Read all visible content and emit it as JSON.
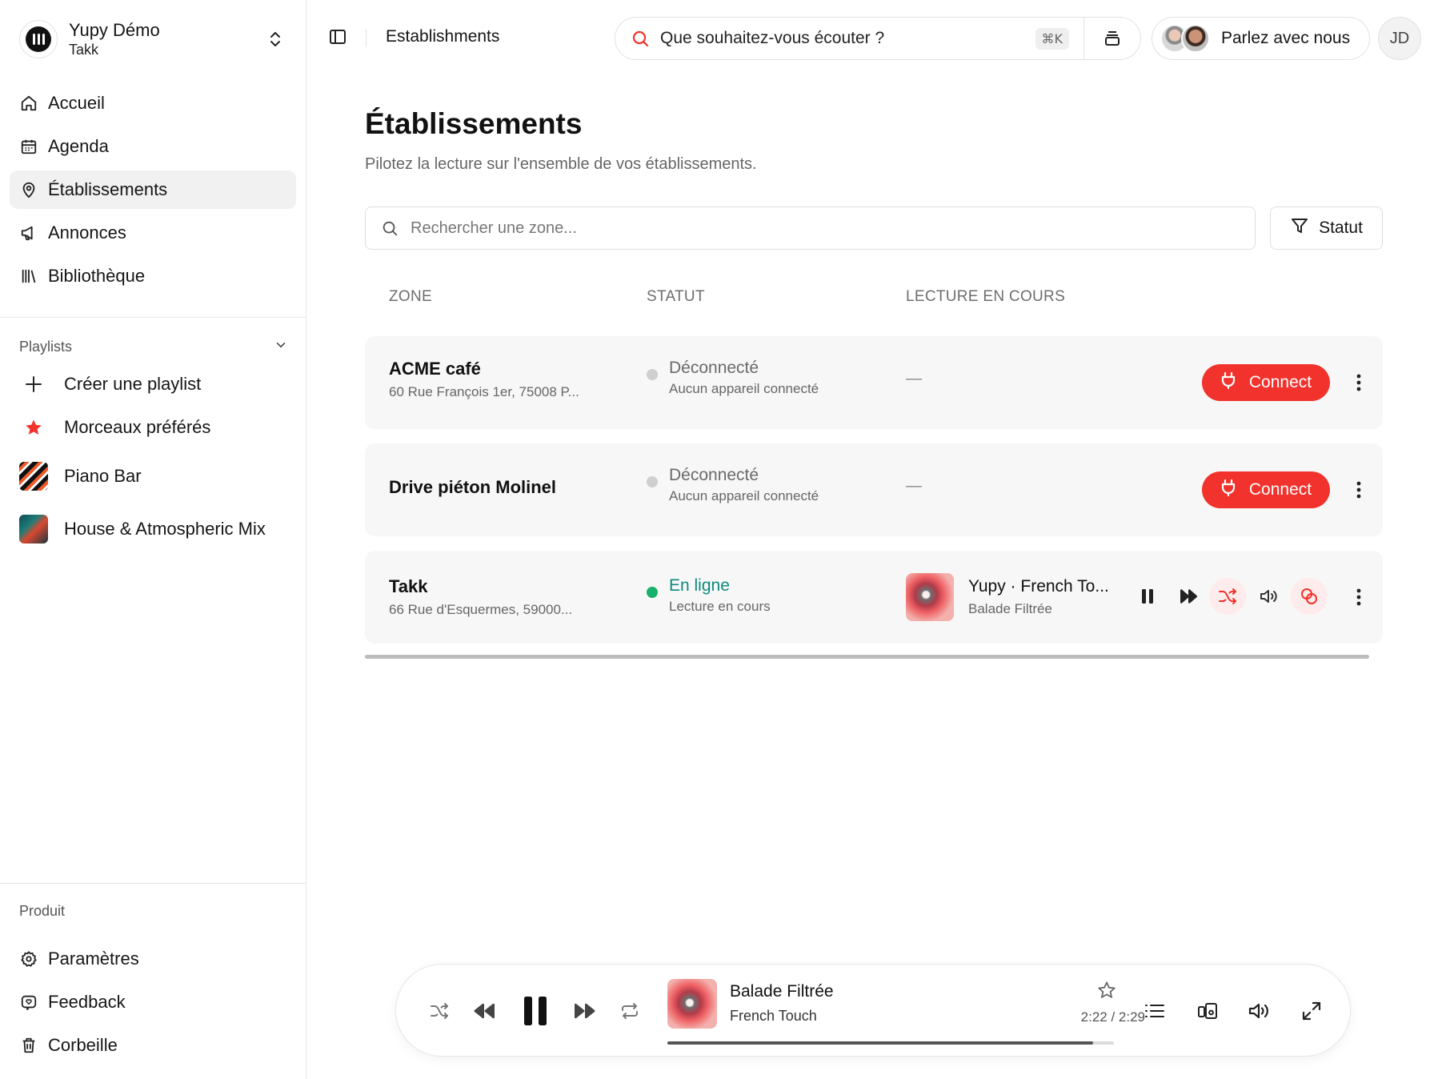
{
  "sidebar": {
    "account": {
      "name": "Yupy Démo",
      "sub": "Takk"
    },
    "nav": [
      {
        "label": "Accueil",
        "icon": "home-icon"
      },
      {
        "label": "Agenda",
        "icon": "calendar-icon"
      },
      {
        "label": "Établissements",
        "icon": "map-pin-icon",
        "active": true
      },
      {
        "label": "Annonces",
        "icon": "megaphone-icon"
      },
      {
        "label": "Bibliothèque",
        "icon": "library-icon"
      }
    ],
    "playlists_header": "Playlists",
    "playlists": [
      {
        "label": "Créer une playlist",
        "icon": "plus-icon"
      },
      {
        "label": "Morceaux préférés",
        "icon": "star-icon"
      },
      {
        "label": "Piano Bar",
        "icon": "playlist-cover"
      },
      {
        "label": "House & Atmospheric Mix",
        "icon": "playlist-cover"
      }
    ],
    "product_header": "Produit",
    "product_nav": [
      {
        "label": "Paramètres",
        "icon": "gear-icon"
      },
      {
        "label": "Feedback",
        "icon": "heart-chat-icon"
      },
      {
        "label": "Corbeille",
        "icon": "trash-icon"
      }
    ]
  },
  "topbar": {
    "breadcrumb": "Establishments",
    "search_placeholder": "Que souhaitez-vous écouter ?",
    "search_shortcut": "⌘K",
    "talk_label": "Parlez avec nous",
    "user_initials": "JD"
  },
  "main": {
    "title": "Établissements",
    "subtitle": "Pilotez la lecture sur l'ensemble de vos établissements.",
    "zone_search_placeholder": "Rechercher une zone...",
    "filter_label": "Statut",
    "columns": {
      "zone": "ZONE",
      "status": "STATUT",
      "playing": "LECTURE EN COURS"
    },
    "connect_label": "Connect",
    "rows": [
      {
        "name": "ACME café",
        "address": "60 Rue François 1er, 75008 P...",
        "status": "Déconnecté",
        "status_sub": "Aucun appareil connecté",
        "playing": "—"
      },
      {
        "name": "Drive piéton Molinel",
        "address": "",
        "status": "Déconnecté",
        "status_sub": "Aucun appareil connecté",
        "playing": "—"
      },
      {
        "name": "Takk",
        "address": "66 Rue d'Esquermes, 59000...",
        "status": "En ligne",
        "status_sub": "Lecture en cours",
        "track_title": "Yupy · French To...",
        "track_sub": "Balade Filtrée"
      }
    ]
  },
  "player": {
    "title": "Balade Filtrée",
    "artist": "French Touch",
    "time": "2:22 / 2:29",
    "progress": 0.953
  },
  "colors": {
    "accent_red": "#f2322c",
    "online_green": "#16b26a",
    "online_text": "#0d8a7c"
  }
}
